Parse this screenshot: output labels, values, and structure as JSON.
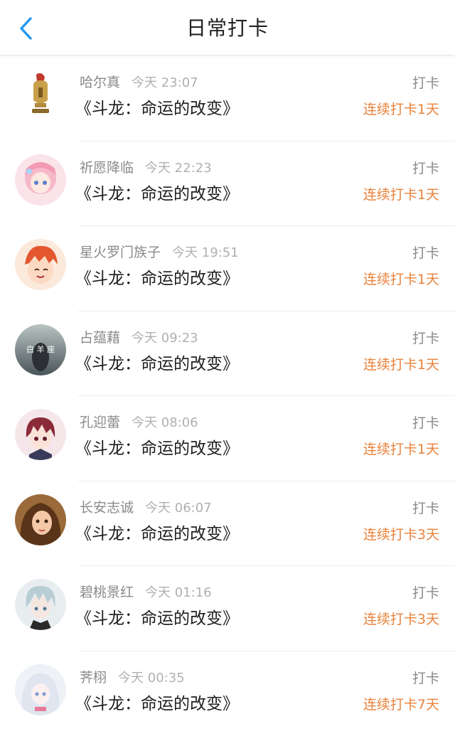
{
  "header": {
    "title": "日常打卡"
  },
  "entries": [
    {
      "user": "哈尔真",
      "time": "今天 23:07",
      "book": "《斗龙：命运的改变》",
      "checkin": "打卡",
      "streak": "连续打卡1天",
      "avatar": "helmet-avatar"
    },
    {
      "user": "祈愿降临",
      "time": "今天 22:23",
      "book": "《斗龙：命运的改变》",
      "checkin": "打卡",
      "streak": "连续打卡1天",
      "avatar": "pink-anime-girl-avatar"
    },
    {
      "user": "星火罗门族子",
      "time": "今天 19:51",
      "book": "《斗龙：命运的改变》",
      "checkin": "打卡",
      "streak": "连续打卡1天",
      "avatar": "red-hair-boy-avatar"
    },
    {
      "user": "占蕴藉",
      "time": "今天 09:23",
      "book": "《斗龙：命运的改变》",
      "checkin": "打卡",
      "streak": "连续打卡1天",
      "avatar": "aries-avatar"
    },
    {
      "user": "孔迎蕾",
      "time": "今天 08:06",
      "book": "《斗龙：命运的改变》",
      "checkin": "打卡",
      "streak": "连续打卡1天",
      "avatar": "anime-boy-avatar"
    },
    {
      "user": "长安志诚",
      "time": "今天 06:07",
      "book": "《斗龙：命运的改变》",
      "checkin": "打卡",
      "streak": "连续打卡3天",
      "avatar": "girl-photo-avatar"
    },
    {
      "user": "碧桃景红",
      "time": "今天 01:16",
      "book": "《斗龙：命运的改变》",
      "checkin": "打卡",
      "streak": "连续打卡3天",
      "avatar": "silver-hair-boy-avatar"
    },
    {
      "user": "荠栩",
      "time": "今天 00:35",
      "book": "《斗龙：命运的改变》",
      "checkin": "打卡",
      "streak": "连续打卡7天",
      "avatar": "white-hair-girl-avatar"
    }
  ],
  "colors": {
    "accent_back": "#2196f3",
    "streak": "#e8823b"
  }
}
